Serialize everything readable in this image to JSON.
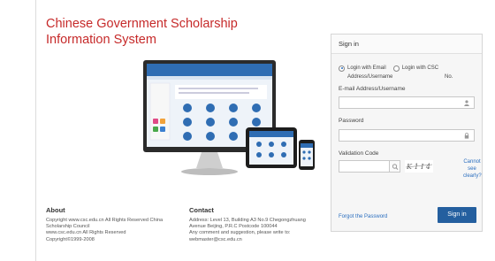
{
  "header": {
    "title_line1": "Chinese Government Scholarship",
    "title_line2": "Information System"
  },
  "signin": {
    "heading": "Sign in",
    "options": [
      {
        "label": "Login with Email",
        "selected": true
      },
      {
        "label": "Login with CSC",
        "selected": false
      }
    ],
    "option_sub": "Address/Username",
    "option_sub2": "No.",
    "email_label": "E-mail Address/Username",
    "password_label": "Password",
    "validation_label": "Validation Code",
    "captcha_text": "K 1 I 4",
    "cannot_see": [
      "Cannot",
      "see",
      "clearly?"
    ],
    "forgot": "Forgot the Password",
    "submit": "Sign in",
    "icons": {
      "user": "user-icon",
      "lock": "lock-icon",
      "search": "magnifier-icon"
    }
  },
  "footer": {
    "about": {
      "heading": "About",
      "lines": [
        "Copyright www.csc.edu.cn All Rights Reserved  China",
        "Scholarship Council",
        "www.csc.edu.cn All Rights Reserved",
        "Copyright©1999-2008"
      ]
    },
    "contact": {
      "heading": "Contact",
      "lines": [
        "Address: Level 13, Building A3 No.9 Chegongzhuang",
        "Avenue Beijing, P.R.C Postcode 100044",
        "Any comment and suggestion, please write to:",
        "webmaster@csc.edu.cn"
      ]
    }
  },
  "colors": {
    "title": "#c62a2a",
    "link": "#2a6ebf",
    "button": "#245f9f"
  }
}
